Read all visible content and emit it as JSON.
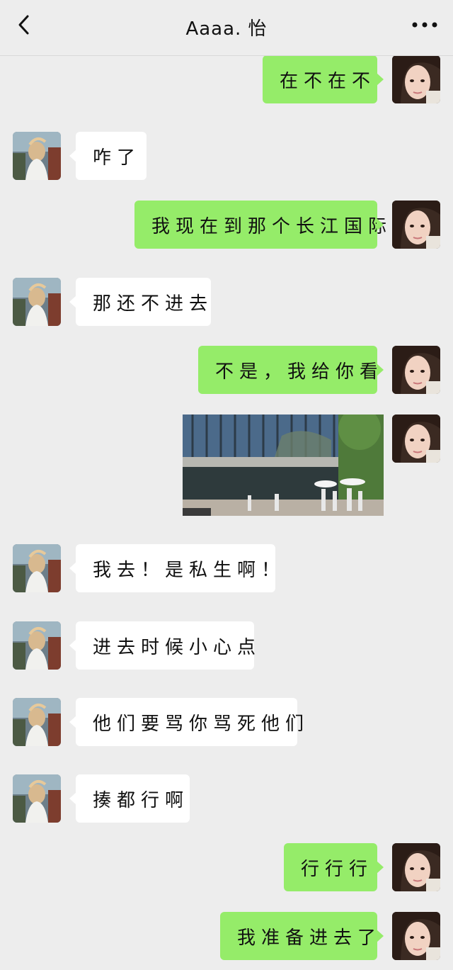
{
  "header": {
    "title": "Aaaa. 怡"
  },
  "icons": {
    "back": "chevron-left-icon",
    "more": "more-dots-icon"
  },
  "colors": {
    "background": "#ededed",
    "sent_bubble": "#95ec69",
    "received_bubble": "#ffffff"
  },
  "messages": [
    {
      "side": "right",
      "type": "text",
      "text": "在不在不"
    },
    {
      "side": "left",
      "type": "text",
      "text": "咋了"
    },
    {
      "side": "right",
      "type": "text",
      "text": "我现在到那个长江国际"
    },
    {
      "side": "left",
      "type": "text",
      "text": "那还不进去"
    },
    {
      "side": "right",
      "type": "text",
      "text": "不是，我给你看"
    },
    {
      "side": "right",
      "type": "image",
      "image": "building-photo"
    },
    {
      "side": "left",
      "type": "text",
      "text": "我去！是私生啊！"
    },
    {
      "side": "left",
      "type": "text",
      "text": "进去时候小心点"
    },
    {
      "side": "left",
      "type": "text",
      "text": "他们要骂你骂死他们"
    },
    {
      "side": "left",
      "type": "text",
      "text": "揍都行啊"
    },
    {
      "side": "right",
      "type": "text",
      "text": "行行行"
    },
    {
      "side": "right",
      "type": "text",
      "text": "我准备进去了"
    }
  ]
}
